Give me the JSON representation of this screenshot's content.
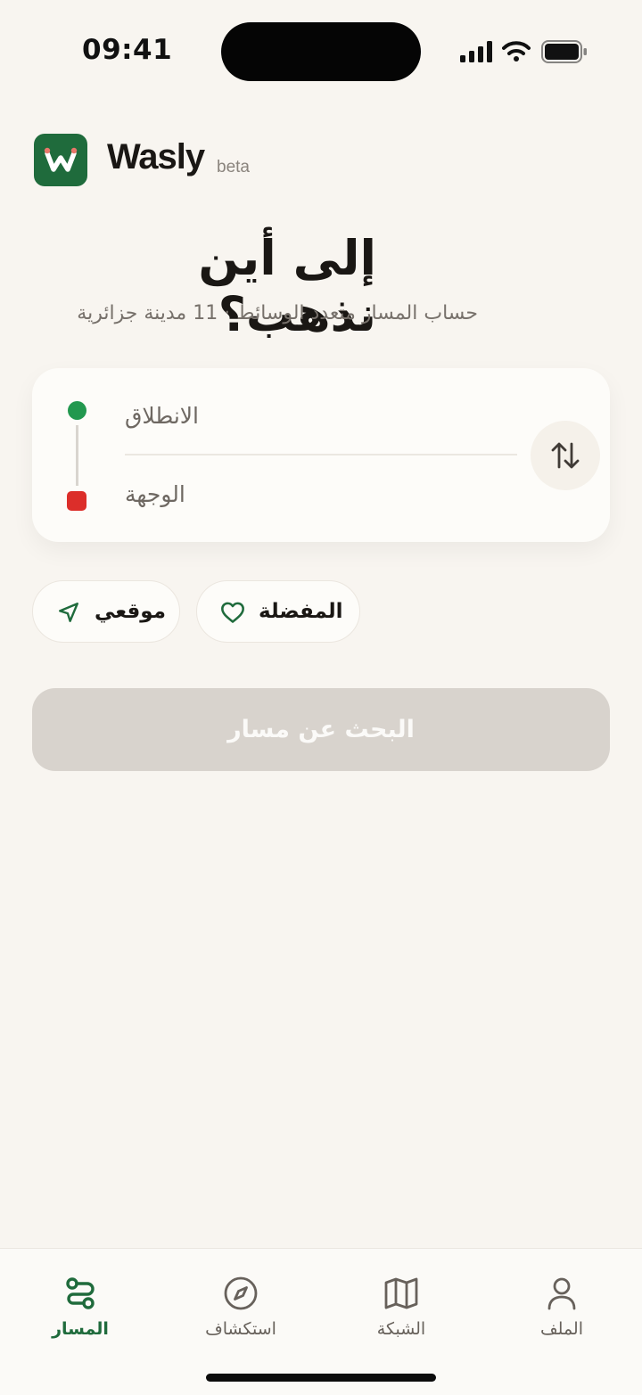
{
  "status_bar": {
    "time": "09:41",
    "icons": [
      "signal-icon",
      "wifi-icon",
      "battery-icon"
    ]
  },
  "brand": {
    "logo_letter": "W",
    "name": "Wasly",
    "badge": "beta",
    "color": "#1f6b3c"
  },
  "hero": {
    "title": "إلى أين نذهب؟",
    "subtitle": "حساب المسار متعدد الوسائط · 11 مدينة جزائرية"
  },
  "route_card": {
    "origin_placeholder": "الانطلاق",
    "destination_placeholder": "الوجهة",
    "origin_color": "#22984f",
    "destination_color": "#dc2e2a",
    "swap_icon": "swap-vertical-icon"
  },
  "chips": [
    {
      "label": "موقعي",
      "icon": "navigation-arrow-icon"
    },
    {
      "label": "المفضلة",
      "icon": "heart-icon"
    }
  ],
  "search_button": {
    "label": "البحث عن مسار",
    "state": "disabled"
  },
  "bottom_nav": {
    "active_color": "#1f6b3c",
    "items": [
      {
        "label": "المسار",
        "icon": "route-icon",
        "active": true
      },
      {
        "label": "استكشاف",
        "icon": "compass-icon",
        "active": false
      },
      {
        "label": "الشبكة",
        "icon": "map-icon",
        "active": false
      },
      {
        "label": "الملف",
        "icon": "user-icon",
        "active": false
      }
    ]
  }
}
